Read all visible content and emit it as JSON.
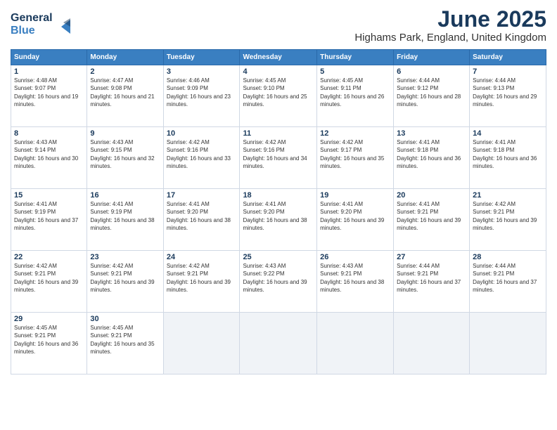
{
  "header": {
    "logo_line1": "General",
    "logo_line2": "Blue",
    "title": "June 2025",
    "subtitle": "Highams Park, England, United Kingdom"
  },
  "days_of_week": [
    "Sunday",
    "Monday",
    "Tuesday",
    "Wednesday",
    "Thursday",
    "Friday",
    "Saturday"
  ],
  "weeks": [
    [
      {
        "day": "1",
        "info": "Sunrise: 4:48 AM\nSunset: 9:07 PM\nDaylight: 16 hours and 19 minutes."
      },
      {
        "day": "2",
        "info": "Sunrise: 4:47 AM\nSunset: 9:08 PM\nDaylight: 16 hours and 21 minutes."
      },
      {
        "day": "3",
        "info": "Sunrise: 4:46 AM\nSunset: 9:09 PM\nDaylight: 16 hours and 23 minutes."
      },
      {
        "day": "4",
        "info": "Sunrise: 4:45 AM\nSunset: 9:10 PM\nDaylight: 16 hours and 25 minutes."
      },
      {
        "day": "5",
        "info": "Sunrise: 4:45 AM\nSunset: 9:11 PM\nDaylight: 16 hours and 26 minutes."
      },
      {
        "day": "6",
        "info": "Sunrise: 4:44 AM\nSunset: 9:12 PM\nDaylight: 16 hours and 28 minutes."
      },
      {
        "day": "7",
        "info": "Sunrise: 4:44 AM\nSunset: 9:13 PM\nDaylight: 16 hours and 29 minutes."
      }
    ],
    [
      {
        "day": "8",
        "info": "Sunrise: 4:43 AM\nSunset: 9:14 PM\nDaylight: 16 hours and 30 minutes."
      },
      {
        "day": "9",
        "info": "Sunrise: 4:43 AM\nSunset: 9:15 PM\nDaylight: 16 hours and 32 minutes."
      },
      {
        "day": "10",
        "info": "Sunrise: 4:42 AM\nSunset: 9:16 PM\nDaylight: 16 hours and 33 minutes."
      },
      {
        "day": "11",
        "info": "Sunrise: 4:42 AM\nSunset: 9:16 PM\nDaylight: 16 hours and 34 minutes."
      },
      {
        "day": "12",
        "info": "Sunrise: 4:42 AM\nSunset: 9:17 PM\nDaylight: 16 hours and 35 minutes."
      },
      {
        "day": "13",
        "info": "Sunrise: 4:41 AM\nSunset: 9:18 PM\nDaylight: 16 hours and 36 minutes."
      },
      {
        "day": "14",
        "info": "Sunrise: 4:41 AM\nSunset: 9:18 PM\nDaylight: 16 hours and 36 minutes."
      }
    ],
    [
      {
        "day": "15",
        "info": "Sunrise: 4:41 AM\nSunset: 9:19 PM\nDaylight: 16 hours and 37 minutes."
      },
      {
        "day": "16",
        "info": "Sunrise: 4:41 AM\nSunset: 9:19 PM\nDaylight: 16 hours and 38 minutes."
      },
      {
        "day": "17",
        "info": "Sunrise: 4:41 AM\nSunset: 9:20 PM\nDaylight: 16 hours and 38 minutes."
      },
      {
        "day": "18",
        "info": "Sunrise: 4:41 AM\nSunset: 9:20 PM\nDaylight: 16 hours and 38 minutes."
      },
      {
        "day": "19",
        "info": "Sunrise: 4:41 AM\nSunset: 9:20 PM\nDaylight: 16 hours and 39 minutes."
      },
      {
        "day": "20",
        "info": "Sunrise: 4:41 AM\nSunset: 9:21 PM\nDaylight: 16 hours and 39 minutes."
      },
      {
        "day": "21",
        "info": "Sunrise: 4:42 AM\nSunset: 9:21 PM\nDaylight: 16 hours and 39 minutes."
      }
    ],
    [
      {
        "day": "22",
        "info": "Sunrise: 4:42 AM\nSunset: 9:21 PM\nDaylight: 16 hours and 39 minutes."
      },
      {
        "day": "23",
        "info": "Sunrise: 4:42 AM\nSunset: 9:21 PM\nDaylight: 16 hours and 39 minutes."
      },
      {
        "day": "24",
        "info": "Sunrise: 4:42 AM\nSunset: 9:21 PM\nDaylight: 16 hours and 39 minutes."
      },
      {
        "day": "25",
        "info": "Sunrise: 4:43 AM\nSunset: 9:22 PM\nDaylight: 16 hours and 39 minutes."
      },
      {
        "day": "26",
        "info": "Sunrise: 4:43 AM\nSunset: 9:21 PM\nDaylight: 16 hours and 38 minutes."
      },
      {
        "day": "27",
        "info": "Sunrise: 4:44 AM\nSunset: 9:21 PM\nDaylight: 16 hours and 37 minutes."
      },
      {
        "day": "28",
        "info": "Sunrise: 4:44 AM\nSunset: 9:21 PM\nDaylight: 16 hours and 37 minutes."
      }
    ],
    [
      {
        "day": "29",
        "info": "Sunrise: 4:45 AM\nSunset: 9:21 PM\nDaylight: 16 hours and 36 minutes."
      },
      {
        "day": "30",
        "info": "Sunrise: 4:45 AM\nSunset: 9:21 PM\nDaylight: 16 hours and 35 minutes."
      },
      null,
      null,
      null,
      null,
      null
    ]
  ]
}
